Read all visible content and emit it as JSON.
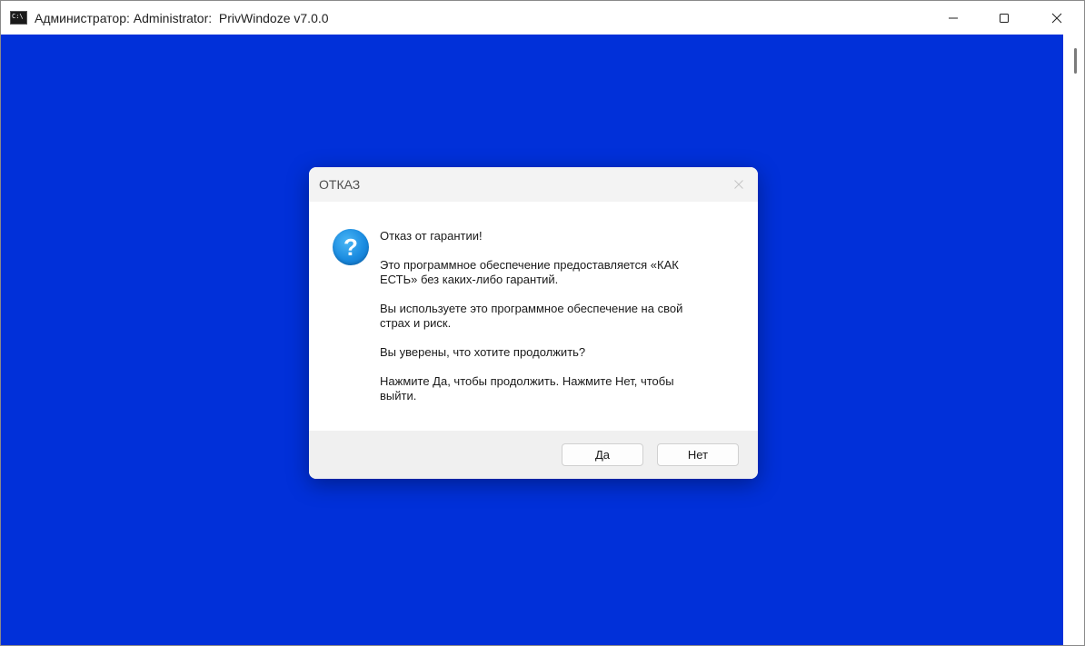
{
  "window": {
    "title": "Администратор: Administrator:  PrivWindoze v7.0.0",
    "icon": "console-icon",
    "controls": [
      "minimize-icon",
      "maximize-icon",
      "close-icon"
    ]
  },
  "console": {
    "background_color": "#0130d9"
  },
  "dialog": {
    "title": "ОТКАЗ",
    "icon": "question-icon",
    "icon_glyph": "?",
    "messages": [
      "Отказ от гарантии!",
      "Это программное обеспечение предоставляется «КАК\nЕСТЬ» без каких-либо гарантий.",
      "Вы используете это программное обеспечение на свой\nстрах и риск.",
      "Вы уверены, что хотите продолжить?",
      "Нажмите Да, чтобы продолжить. Нажмите Нет, чтобы\nвыйти."
    ],
    "buttons": {
      "yes_label": "Да",
      "no_label": "Нет"
    }
  }
}
